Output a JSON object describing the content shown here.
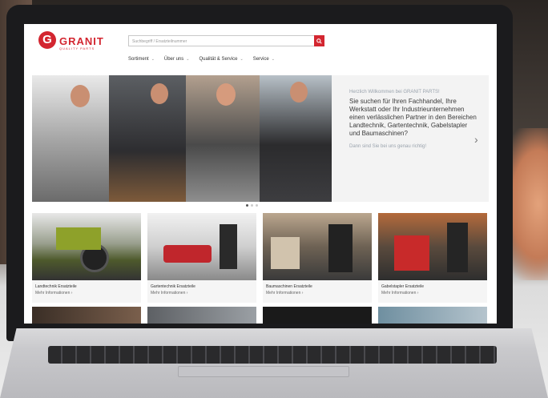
{
  "brand": {
    "logo_letter": "G",
    "name": "GRANIT",
    "tagline": "QUALITY PARTS",
    "accent_color": "#d32630"
  },
  "search": {
    "placeholder": "Suchbegriff / Ersatzteilnummer",
    "icon": "search-icon"
  },
  "nav": {
    "items": [
      {
        "label": "Sortiment"
      },
      {
        "label": "Über uns"
      },
      {
        "label": "Qualität & Service"
      },
      {
        "label": "Service"
      }
    ]
  },
  "hero": {
    "greeting": "Herzlich Willkommen bei GRANIT PARTS!",
    "body": "Sie suchen für Ihren Fachhandel, Ihre Werkstatt oder Ihr Industrieunternehmen einen verlässlichen Partner in den Bereichen Landtechnik, Gartentechnik, Gabelstapler und Baumaschinen?",
    "cta": "Dann sind Sie bei uns genau richtig!",
    "next_icon": "chevron-right-icon",
    "slides_total": 3,
    "active_slide": 1
  },
  "categories": [
    {
      "title": "Landtechnik Ersatzteile",
      "more": "Mehr Informationen"
    },
    {
      "title": "Gartentechnik Ersatzteile",
      "more": "Mehr Informationen"
    },
    {
      "title": "Baumaschinen Ersatzteile",
      "more": "Mehr Informationen"
    },
    {
      "title": "Gabelstapler Ersatzteile",
      "more": "Mehr Informationen"
    }
  ]
}
